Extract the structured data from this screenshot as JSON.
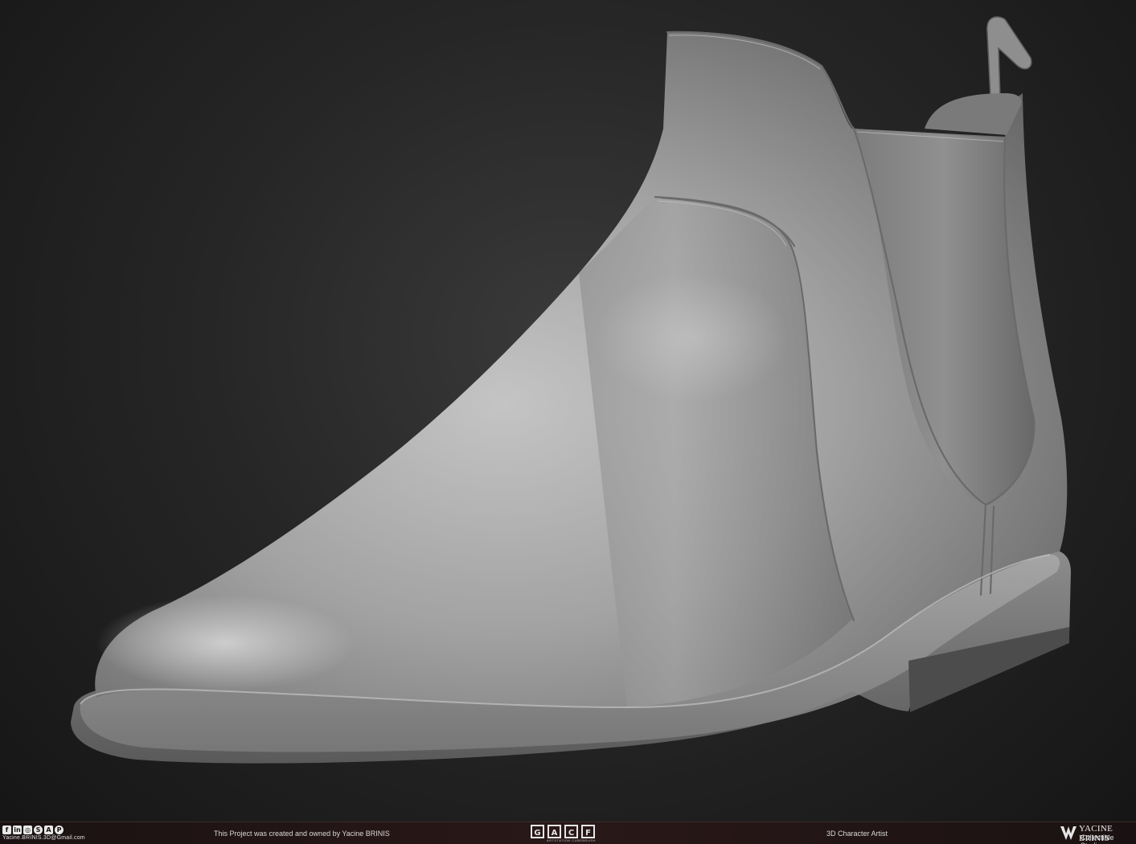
{
  "render": {
    "subject": "chelsea-boot-sculpt",
    "colors": {
      "background": "#202020",
      "clay": "#8f8f8f",
      "clay_highlight": "#bdbdbd",
      "clay_shadow": "#4a4a4a"
    }
  },
  "footer": {
    "social_icons": [
      "facebook-icon",
      "linkedin-icon",
      "instagram-icon",
      "skype-icon",
      "artstation-icon",
      "pinterest-icon"
    ],
    "social_glyphs": [
      "f",
      "in",
      "◎",
      "S",
      "A",
      "P"
    ],
    "email": "Yacine.BRINIS.3D@Gmail.com",
    "credit": "This Project was created and owned by Yacine BRINIS",
    "logo_glyphs": [
      "G",
      "A",
      "C",
      "F"
    ],
    "logo_caption": "ARTSTATION  CUBEBRUSH",
    "role": "3D Character Artist",
    "brand_name": "YACINE BRINIS",
    "brand_sub": "Collectible Studios"
  }
}
